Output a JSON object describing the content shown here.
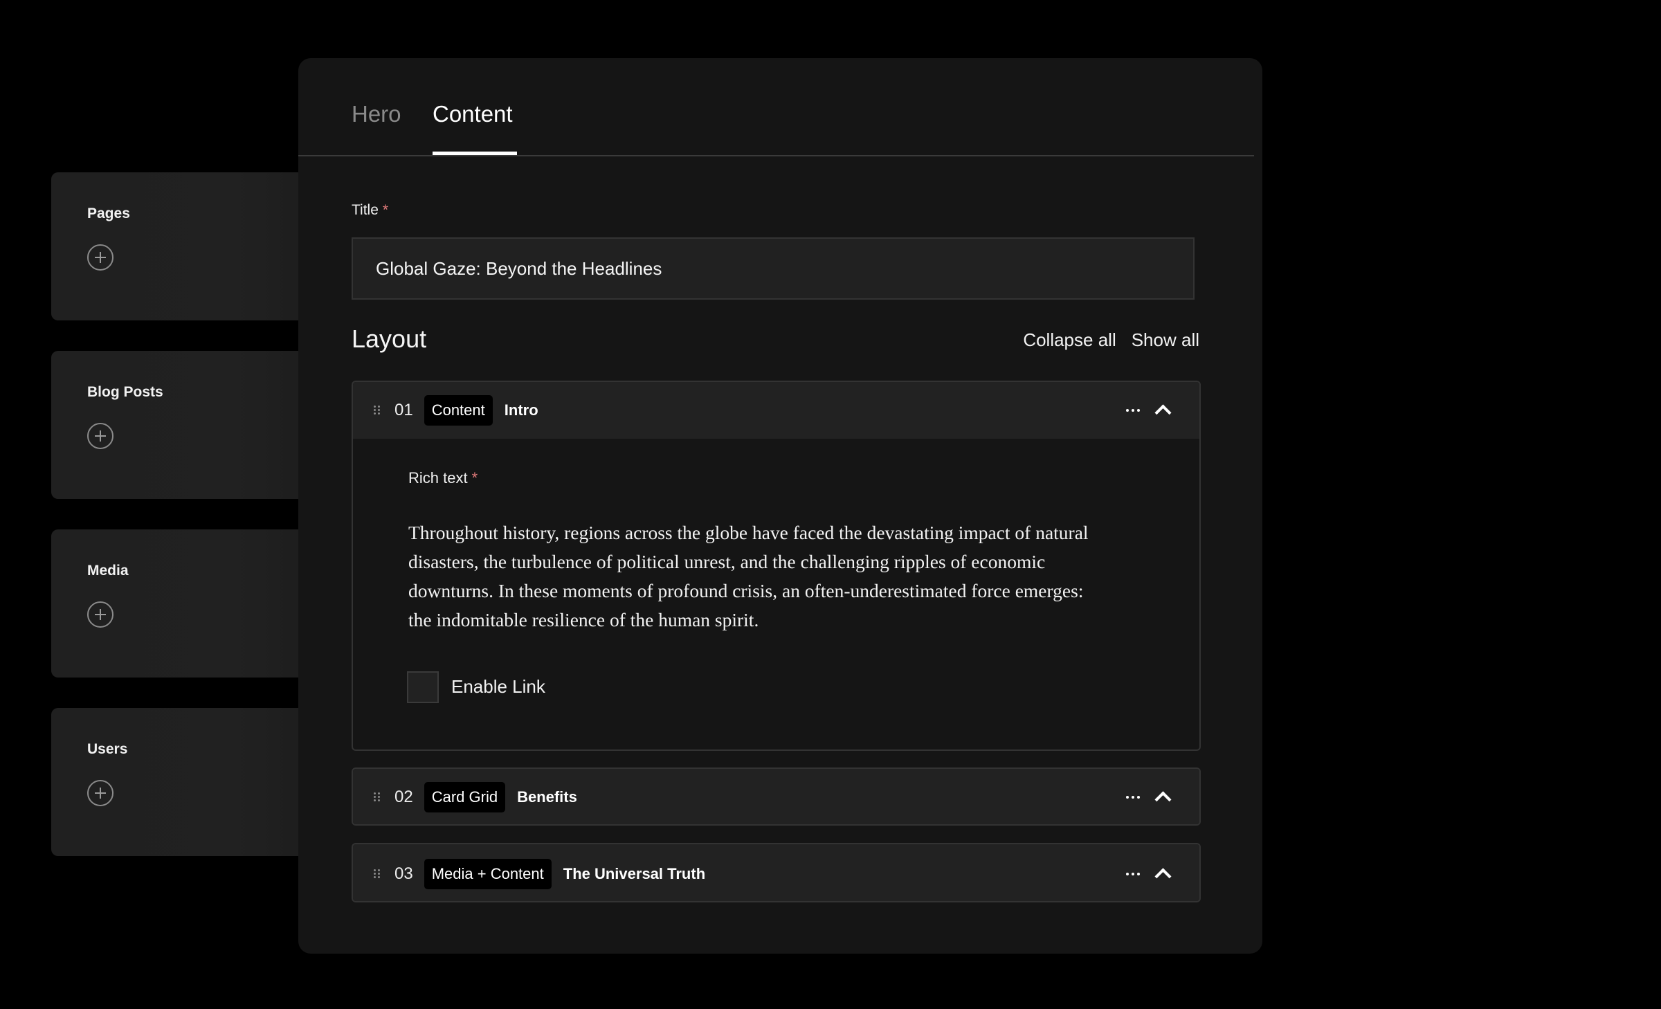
{
  "sidebar": {
    "collections": [
      {
        "label": "Pages",
        "add_icon": "plus-circle-icon"
      },
      {
        "label": "Blog Posts",
        "add_icon": "plus-circle-icon"
      },
      {
        "label": "Media",
        "add_icon": "plus-circle-icon"
      },
      {
        "label": "Users",
        "add_icon": "plus-circle-icon"
      }
    ]
  },
  "editor": {
    "tabs": [
      {
        "label": "Hero",
        "active": false
      },
      {
        "label": "Content",
        "active": true
      }
    ],
    "title_field": {
      "label": "Title",
      "required_marker": "*",
      "value": "Global Gaze: Beyond the Headlines"
    },
    "layout": {
      "heading": "Layout",
      "collapse_all": "Collapse all",
      "show_all": "Show all",
      "blocks": [
        {
          "number": "01",
          "type": "Content",
          "name": "Intro",
          "expanded": true,
          "rich_text_label": "Rich text",
          "required_marker": "*",
          "rich_text": "Throughout history, regions across the globe have faced the devastating impact of natural disasters, the turbulence of political unrest, and the challenging ripples of economic downturns. In these moments of profound crisis, an often-underestimated force emerges: the indomitable resilience of the human spirit.",
          "enable_link_label": "Enable Link",
          "enable_link_checked": false
        },
        {
          "number": "02",
          "type": "Card Grid",
          "name": "Benefits",
          "expanded": false
        },
        {
          "number": "03",
          "type": "Media + Content",
          "name": "The Universal Truth",
          "expanded": false
        }
      ]
    }
  },
  "colors": {
    "background": "#000000",
    "panel": "#151515",
    "card": "#212121",
    "required": "#e07a7a",
    "text": "#ffffff",
    "muted_tab": "#8a8a8a"
  }
}
